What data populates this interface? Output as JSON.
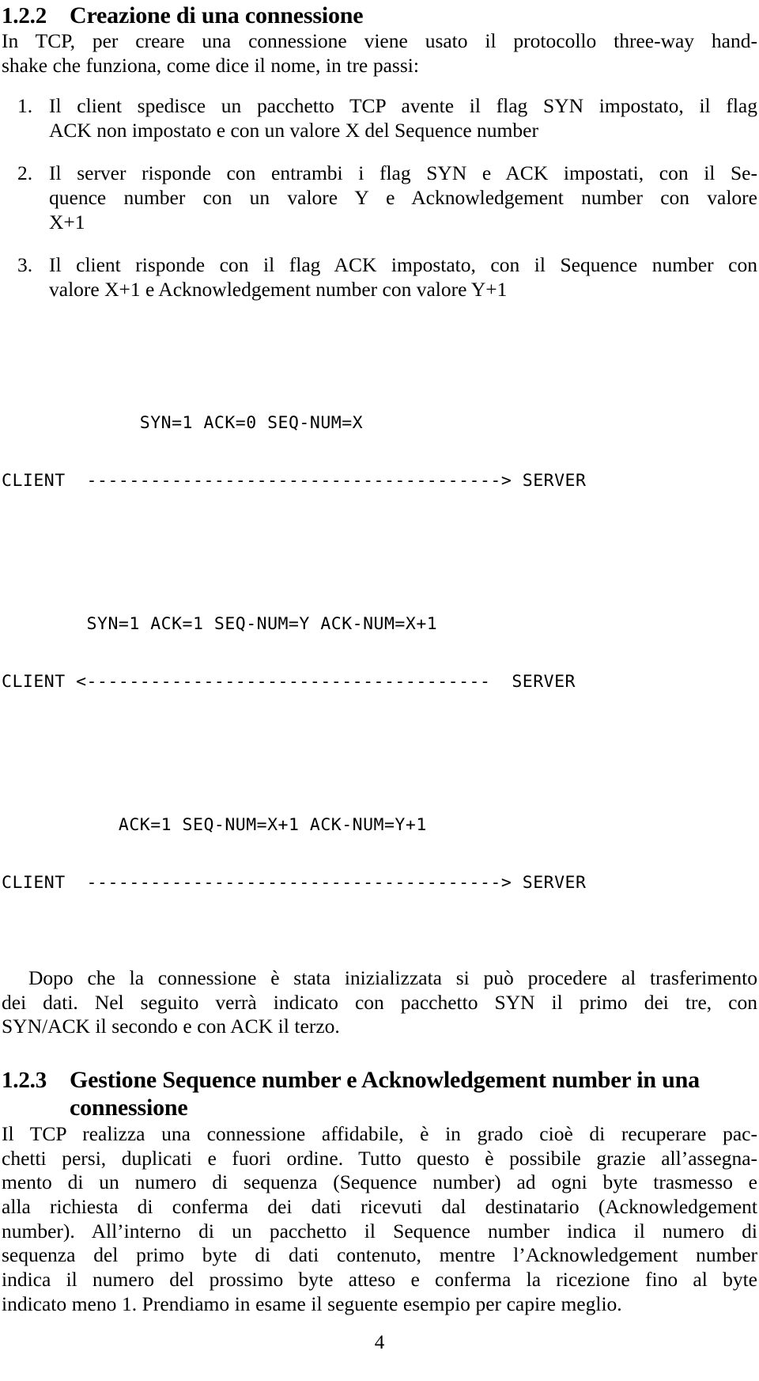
{
  "document": {
    "page_number": "4"
  },
  "section_122": {
    "number": "1.2.2",
    "title": "Creazione di una connessione",
    "intro_line1": "In TCP, per creare una connessione viene usato il protocollo three-way hand-",
    "intro_line2": "shake che funziona, come dice il nome, in tre passi:",
    "steps": [
      {
        "marker": "1.",
        "line1": "Il client spedisce un pacchetto TCP avente il flag SYN impostato, il flag",
        "line2": "ACK non impostato e con un valore X del Sequence number"
      },
      {
        "marker": "2.",
        "line1": "Il server risponde con entrambi i flag SYN e ACK impostati, con il Se-",
        "line2": "quence number con un valore Y e Acknowledgement number con valore",
        "line3": "X+1"
      },
      {
        "marker": "3.",
        "line1": "Il client risponde con il flag ACK impostato, con il Sequence number con",
        "line2": "valore X+1 e Acknowledgement number con valore Y+1"
      }
    ],
    "diagram": {
      "exchanges": [
        {
          "flags_label": "             SYN=1 ACK=0 SEQ-NUM=X",
          "arrow_line": "CLIENT  ---------------------------------------> SERVER"
        },
        {
          "flags_label": "        SYN=1 ACK=1 SEQ-NUM=Y ACK-NUM=X+1",
          "arrow_line": "CLIENT <--------------------------------------  SERVER"
        },
        {
          "flags_label": "           ACK=1 SEQ-NUM=X+1 ACK-NUM=Y+1",
          "arrow_line": "CLIENT  ---------------------------------------> SERVER"
        }
      ]
    },
    "closing_paragraph": {
      "line1": "Dopo che la connessione è stata inizializzata si può procedere al trasferimento",
      "line2": "dei dati. Nel seguito verrà indicato con pacchetto SYN il primo dei tre, con",
      "line3": "SYN/ACK il secondo e con ACK il terzo."
    }
  },
  "section_123": {
    "number": "1.2.3",
    "title_line1": "Gestione Sequence number e Acknowledgement number in una",
    "title_line2": "connessione",
    "paragraph": {
      "line1": "Il TCP realizza una connessione affidabile, è in grado cioè di recuperare pac-",
      "line2": "chetti persi, duplicati e fuori ordine. Tutto questo è possibile grazie all’assegna-",
      "line3": "mento di un numero di sequenza (Sequence number) ad ogni byte trasmesso e",
      "line4": "alla richiesta di conferma dei dati ricevuti dal destinatario (Acknowledgement",
      "line5": "number). All’interno di un pacchetto il Sequence number indica il numero di",
      "line6": "sequenza del primo byte di dati contenuto, mentre l’Acknowledgement number",
      "line7": "indica il numero del prossimo byte atteso e conferma la ricezione fino al byte",
      "line8": "indicato meno 1. Prendiamo in esame il seguente esempio per capire meglio."
    }
  }
}
